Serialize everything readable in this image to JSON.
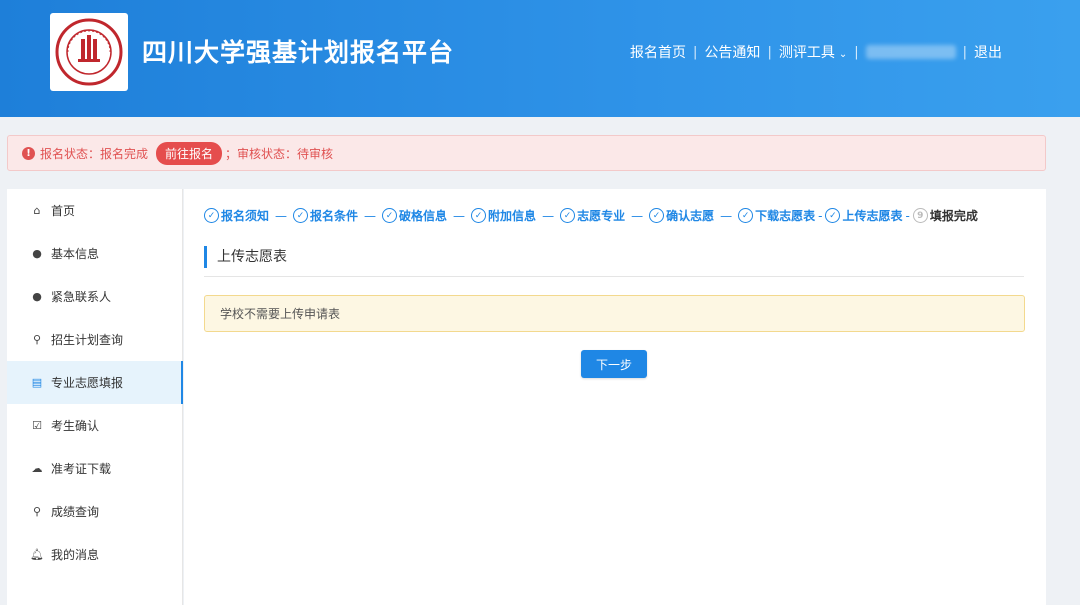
{
  "header": {
    "title": "四川大学强基计划报名平台",
    "logo_alt": "四川大学",
    "nav": {
      "home": "报名首页",
      "notice": "公告通知",
      "tools": "测评工具",
      "logout": "退出"
    }
  },
  "status": {
    "reg_label": "报名状态：报名完成",
    "goto_button": "前往报名",
    "separator": "；",
    "review_label": "审核状态：待审核"
  },
  "sidebar": {
    "items": [
      {
        "label": "首页",
        "icon": "home-icon"
      },
      {
        "label": "基本信息",
        "icon": "user-icon"
      },
      {
        "label": "紧急联系人",
        "icon": "user-icon"
      },
      {
        "label": "招生计划查询",
        "icon": "search-icon"
      },
      {
        "label": "专业志愿填报",
        "icon": "form-icon"
      },
      {
        "label": "考生确认",
        "icon": "checkbox-icon"
      },
      {
        "label": "准考证下载",
        "icon": "cloud-download-icon"
      },
      {
        "label": "成绩查询",
        "icon": "search-icon"
      },
      {
        "label": "我的消息",
        "icon": "bell-icon"
      }
    ]
  },
  "steps": [
    {
      "label": "报名须知"
    },
    {
      "label": "报名条件"
    },
    {
      "label": "破格信息"
    },
    {
      "label": "附加信息"
    },
    {
      "label": "志愿专业"
    },
    {
      "label": "确认志愿"
    },
    {
      "label": "下载志愿表"
    },
    {
      "label": "上传志愿表"
    },
    {
      "label": "填报完成",
      "number": "9"
    }
  ],
  "main": {
    "section_title": "上传志愿表",
    "notice": "学校不需要上传申请表",
    "next_button": "下一步"
  },
  "colors": {
    "primary": "#1f87e5",
    "header_gradient_start": "#1e7fd9",
    "alert_red": "#e05252",
    "notice_bg": "#fdf7e3"
  }
}
